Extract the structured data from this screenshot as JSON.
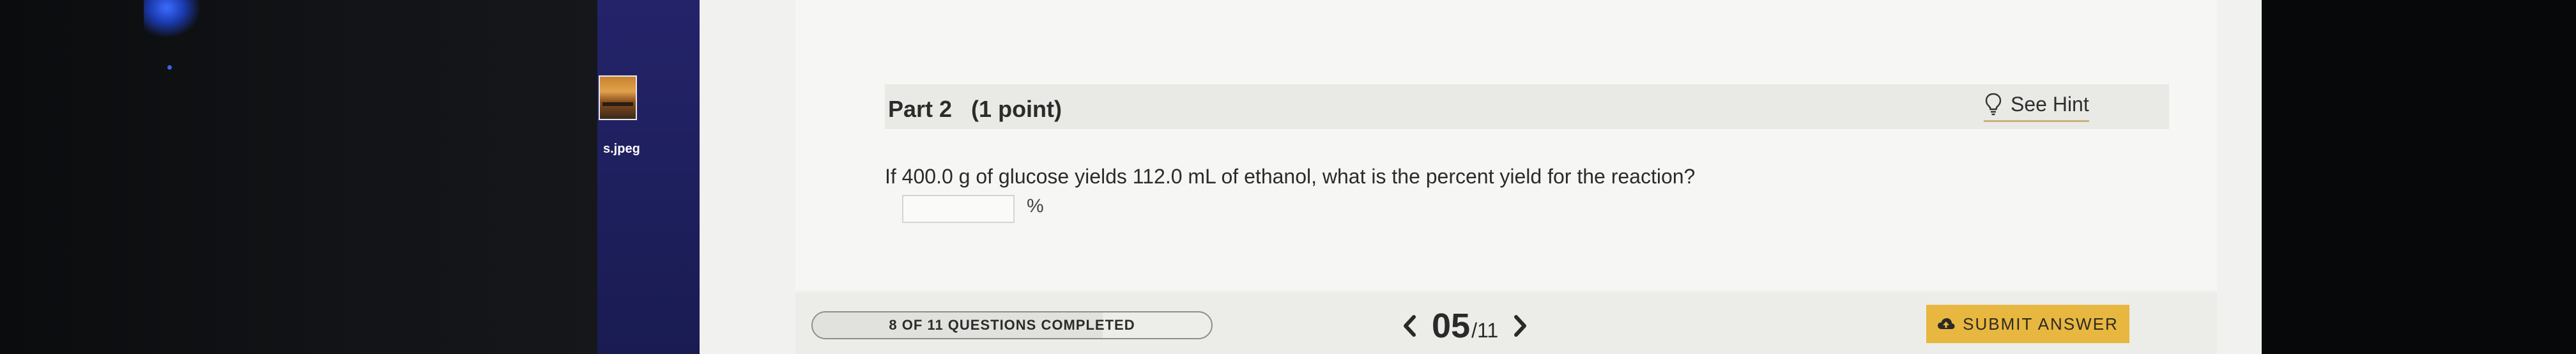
{
  "desktop": {
    "file_label": "s.jpeg"
  },
  "part": {
    "title": "Part 2   (1 point)",
    "hint_label": "See Hint"
  },
  "question": {
    "text": "If 400.0 g of glucose yields 112.0 mL of ethanol, what is the percent yield for the reaction?",
    "answer_value": "",
    "answer_placeholder": "",
    "unit": "%"
  },
  "footer": {
    "progress_text": "8 OF 11 QUESTIONS COMPLETED",
    "progress_fraction": 0.727,
    "page_current": "05",
    "page_total": "/11",
    "submit_label": "SUBMIT ANSWER"
  },
  "icons": {
    "hint": "lightbulb-icon",
    "prev": "chevron-left-icon",
    "next": "chevron-right-icon",
    "submit": "cloud-upload-icon"
  },
  "colors": {
    "accent": "#e8b73f",
    "hint_underline": "#c9b27a",
    "desktop_panel": "#24236a"
  }
}
